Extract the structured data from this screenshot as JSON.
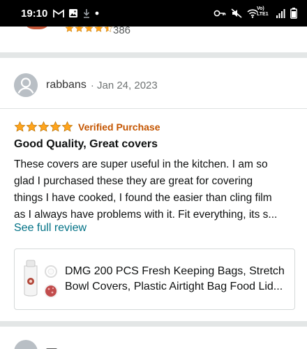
{
  "status_bar": {
    "time": "19:10",
    "left_icons": [
      "gmail-icon",
      "image-icon",
      "download-icon",
      "dot-icon"
    ],
    "right_icons": [
      "key-icon",
      "mute-icon",
      "wifi-icon",
      "signal-icon",
      "battery-icon"
    ],
    "network_label_1": "Vo)",
    "network_label_2": "LTE1"
  },
  "previous_review_peek": {
    "rating_stars": 4.5,
    "rating_count": "386"
  },
  "review": {
    "reviewer_name": "rabbans",
    "date": "· Jan 24, 2023",
    "rating_stars": 5,
    "verified_label": "Verified Purchase",
    "title": "Good Quality, Great covers",
    "body_lines": [
      "These covers are super useful in the kitchen. I am so",
      "glad I purchased these they are great for covering",
      "things I have cooked, I found the easier than cling film",
      "as I always have problems with it. Fit everything, its s..."
    ],
    "see_full_label": "See full review"
  },
  "product": {
    "title_lines": [
      "DMG 200 PCS Fresh Keeping Bags, Stretch",
      "Bowl Covers, Plastic Airtight Bag Food Lid..."
    ]
  },
  "colors": {
    "star": "#ffa41c",
    "verified": "#c45500",
    "link": "#007185",
    "divider": "#e3e6e6"
  }
}
